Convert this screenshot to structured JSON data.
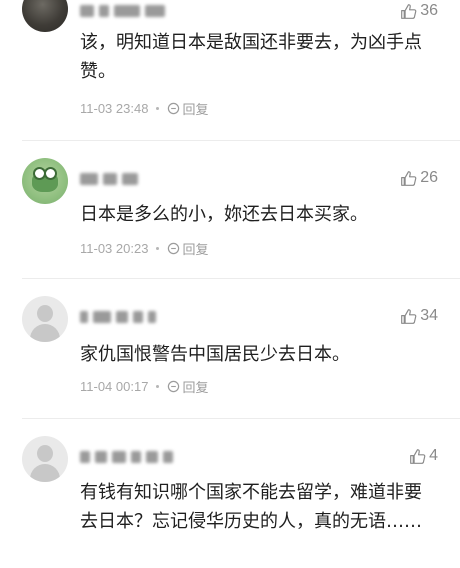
{
  "comments": [
    {
      "avatar": "dark-photo-avatar",
      "likes": "36",
      "text": "该，明知道日本是敌国还非要去，为凶手点赞。",
      "time": "11-03 23:48",
      "reply": "回复"
    },
    {
      "avatar": "green-frog-avatar",
      "likes": "26",
      "text": "日本是多么的小，妳还去日本买家。",
      "time": "11-03 20:23",
      "reply": "回复"
    },
    {
      "avatar": "default-user-avatar",
      "likes": "34",
      "text": "家仇国恨警告中国居民少去日本。",
      "time": "11-04 00:17",
      "reply": "回复"
    },
    {
      "avatar": "default-user-avatar",
      "likes": "4",
      "text": "有钱有知识哪个国家不能去留学，难道非要去日本？忘记侵华历史的人，真的无语……",
      "time": "",
      "reply": ""
    }
  ],
  "icons": {
    "like": "thumbs-up-icon",
    "reply": "reply-icon"
  },
  "colors": {
    "text": "#1f1f1f",
    "meta": "#a8a8a8",
    "likes": "#8a8a8a"
  }
}
